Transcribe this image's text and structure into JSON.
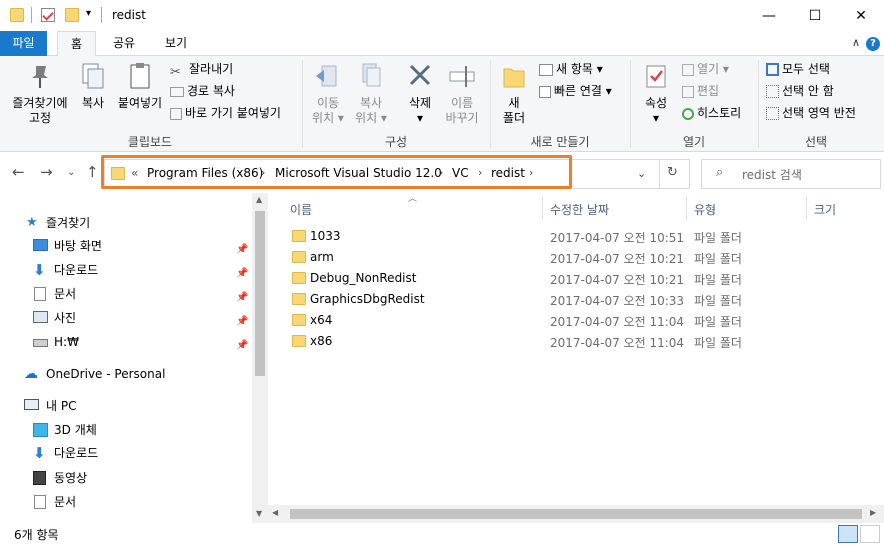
{
  "window": {
    "title": "redist",
    "controls": {
      "minimize": "—",
      "maximize": "☐",
      "close": "✕"
    }
  },
  "ribbon_tabs": [
    {
      "label": "파일"
    },
    {
      "label": "홈"
    },
    {
      "label": "공유"
    },
    {
      "label": "보기"
    }
  ],
  "ribbon": {
    "clipboard": {
      "label": "클립보드",
      "pin": "즐겨찾기에\n고정",
      "copy": "복사",
      "paste": "붙여넣기",
      "cut": "잘라내기",
      "copy_path": "경로 복사",
      "paste_shortcut": "바로 가기 붙여넣기"
    },
    "organize": {
      "label": "구성",
      "move_to": "이동\n위치 ▾",
      "copy_to": "복사\n위치 ▾",
      "delete": "삭제\n▾",
      "rename": "이름\n바꾸기"
    },
    "new": {
      "label": "새로 만들기",
      "new_folder": "새\n폴더",
      "new_item": "새 항목 ▾",
      "easy_access": "빠른 연결 ▾"
    },
    "open": {
      "label": "열기",
      "properties": "속성\n▾",
      "open": "열기 ▾",
      "edit": "편집",
      "history": "히스토리"
    },
    "select": {
      "label": "선택",
      "select_all": "모두 선택",
      "select_none": "선택 안 함",
      "invert": "선택 영역 반전"
    }
  },
  "address": {
    "prefix": "«",
    "crumbs": [
      "Program Files (x86)",
      "Microsoft Visual Studio 12.0",
      "VC",
      "redist"
    ],
    "search_placeholder": "redist 검색"
  },
  "nav": {
    "quick_access": "즐겨찾기",
    "quick_items": [
      "바탕 화면",
      "다운로드",
      "문서",
      "사진",
      "H:₩"
    ],
    "onedrive": "OneDrive - Personal",
    "this_pc": "내 PC",
    "pc_items": [
      "3D 개체",
      "다운로드",
      "동영상",
      "문서"
    ]
  },
  "columns": {
    "name": "이름",
    "date": "수정한 날짜",
    "type": "유형",
    "size": "크기"
  },
  "files": [
    {
      "name": "1033",
      "date": "2017-04-07 오전 10:51",
      "type": "파일 폴더"
    },
    {
      "name": "arm",
      "date": "2017-04-07 오전 10:21",
      "type": "파일 폴더"
    },
    {
      "name": "Debug_NonRedist",
      "date": "2017-04-07 오전 10:21",
      "type": "파일 폴더"
    },
    {
      "name": "GraphicsDbgRedist",
      "date": "2017-04-07 오전 10:33",
      "type": "파일 폴더"
    },
    {
      "name": "x64",
      "date": "2017-04-07 오전 11:04",
      "type": "파일 폴더"
    },
    {
      "name": "x86",
      "date": "2017-04-07 오전 11:04",
      "type": "파일 폴더"
    }
  ],
  "status": {
    "count": "6개 항목"
  },
  "colors": {
    "accent": "#1979ca",
    "highlight": "#ef7d2a",
    "folder": "#f8d775"
  }
}
